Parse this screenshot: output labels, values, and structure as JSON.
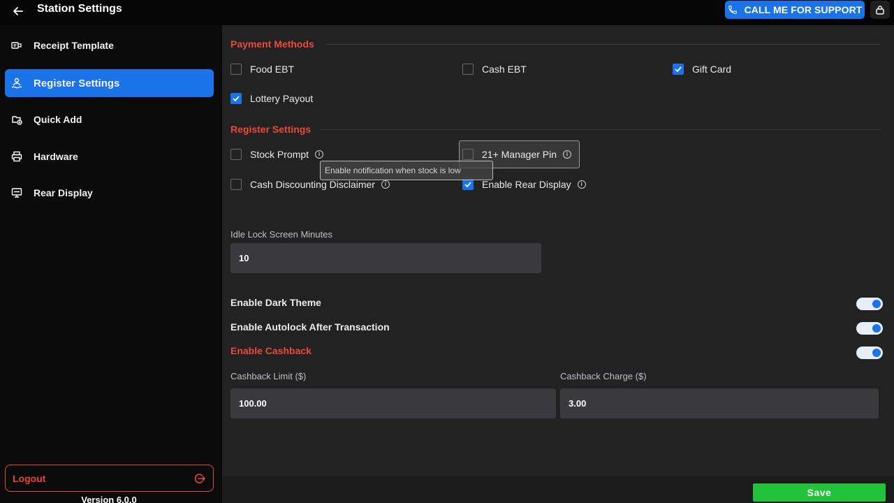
{
  "header": {
    "title": "Station Settings",
    "support_label": "CALL ME FOR SUPPORT"
  },
  "sidebar": {
    "items": [
      {
        "label": "Receipt Template",
        "icon": "receipt-icon",
        "active": false
      },
      {
        "label": "Register Settings",
        "icon": "register-icon",
        "active": true
      },
      {
        "label": "Quick Add",
        "icon": "quick-add-icon",
        "active": false
      },
      {
        "label": "Hardware",
        "icon": "printer-icon",
        "active": false
      },
      {
        "label": "Rear Display",
        "icon": "monitor-icon",
        "active": false
      }
    ],
    "logout_label": "Logout",
    "version": "Version 6.0.0"
  },
  "payment_methods": {
    "title": "Payment Methods",
    "items": [
      {
        "label": "Food EBT",
        "checked": false
      },
      {
        "label": "Cash EBT",
        "checked": false
      },
      {
        "label": "Gift Card",
        "checked": true
      },
      {
        "label": "Lottery Payout",
        "checked": true
      }
    ]
  },
  "register_settings": {
    "title": "Register Settings",
    "items": [
      {
        "label": "Stock Prompt",
        "checked": false,
        "info": true
      },
      {
        "label": "21+ Manager Pin",
        "checked": false,
        "info": true
      },
      {
        "label": "Cash Discounting Disclaimer",
        "checked": false,
        "info": true
      },
      {
        "label": "Enable Rear Display",
        "checked": true,
        "info": true
      }
    ],
    "tooltip": "Enable notification when stock is low"
  },
  "idle_lock": {
    "label": "Idle Lock Screen Minutes",
    "value": "10"
  },
  "toggles": [
    {
      "label": "Enable Dark Theme",
      "on": true
    },
    {
      "label": "Enable Autolock After Transaction",
      "on": true
    },
    {
      "label": "Enable Cashback",
      "on": true
    }
  ],
  "cashback": {
    "limit_label": "Cashback Limit ($)",
    "limit_value": "100.00",
    "charge_label": "Cashback Charge ($)",
    "charge_value": "3.00"
  },
  "footer": {
    "save_label": "Save"
  },
  "colors": {
    "accent": "#1a73e8",
    "danger": "#ea4a3a",
    "success": "#22c33b"
  }
}
